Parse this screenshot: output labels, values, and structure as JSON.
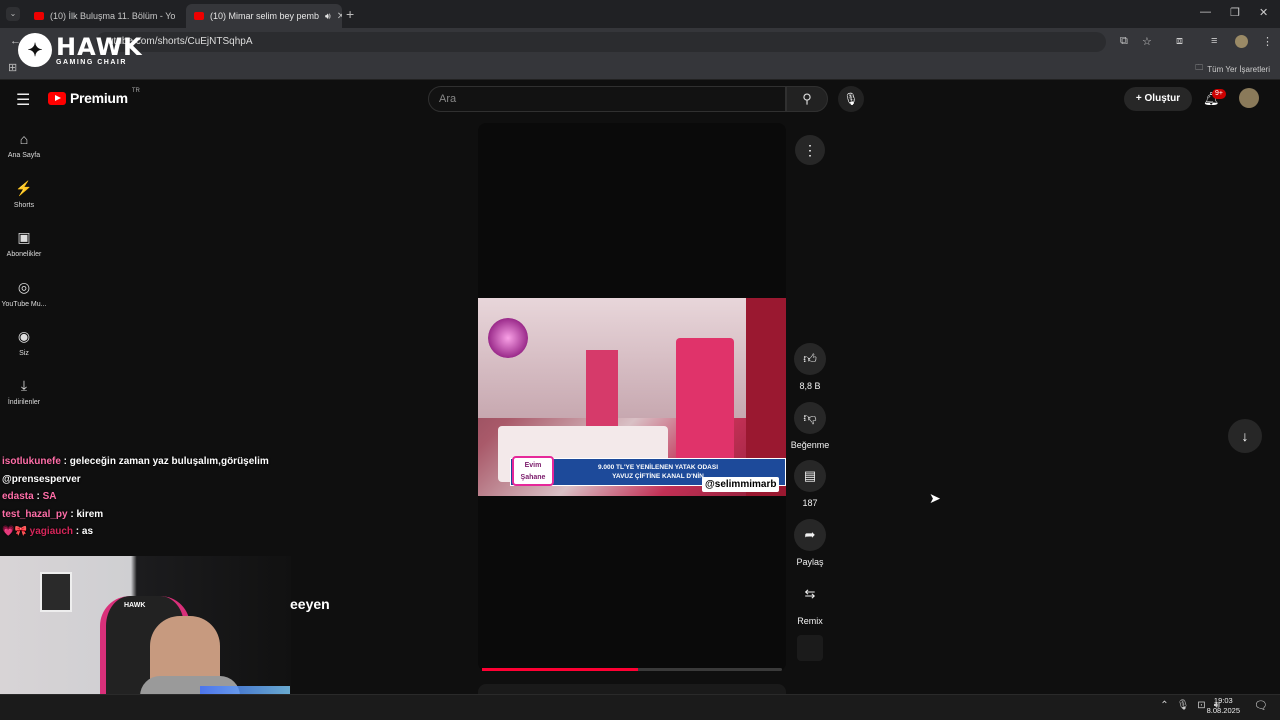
{
  "browser": {
    "tabs": [
      {
        "title": "(10) İlk Buluşma 11. Bölüm - Yo",
        "close": "✕"
      },
      {
        "title": "(10) Mimar selim bey pemb",
        "close": "✕"
      }
    ],
    "new_tab": "+",
    "url": "utube.com/shorts/CuEjNTSqhpA",
    "bookmarks_label": "Tüm Yer İşaretleri",
    "window_controls": [
      "—",
      "❐",
      "✕"
    ]
  },
  "overlay_brand": {
    "name": "HAWK",
    "tagline": "GAMING CHAIR"
  },
  "youtube": {
    "logo_text": "Premium",
    "logo_region": "TR",
    "search_placeholder": "Ara",
    "create_label": "Oluştur",
    "notifications_badge": "9+",
    "guide": [
      {
        "icon": "⌂",
        "label": "Ana Sayfa"
      },
      {
        "icon": "⚡",
        "label": "Shorts"
      },
      {
        "icon": "▣",
        "label": "Abonelikler"
      },
      {
        "icon": "◎",
        "label": "YouTube Mu..."
      },
      {
        "icon": "◉",
        "label": "Siz"
      },
      {
        "icon": "⤓",
        "label": "İndirilenler"
      }
    ],
    "short": {
      "overlay_handle": "@selimmimarb",
      "banner_logo_top": "Evim",
      "banner_logo_bottom": "Şahane",
      "banner_line1": "9.000 TL'YE YENİLENEN YATAK ODASI",
      "banner_line2": "YAVUZ ÇİFTİNE KANAL D'NİN",
      "progress": 0.52
    },
    "actions": {
      "like_count": "8,8 B",
      "dislike_label": "Beğenme",
      "comment_count": "187",
      "share_label": "Paylaş",
      "remix_label": "Remix"
    },
    "ghost_title": "eeyen"
  },
  "chat": [
    {
      "user": "isotlukunefe",
      "message": "geleceğin zaman yaz buluşalım,görüşelim"
    },
    {
      "user": "",
      "message": "@prensesperver"
    },
    {
      "user": "edasta",
      "message": "SA"
    },
    {
      "user": "test_hazal_py",
      "message": "kirem"
    },
    {
      "user": "💗🎀 yagiauch",
      "message": "as"
    }
  ],
  "webcam": {
    "chair_brand": "HAWK"
  },
  "taskbar": {
    "time": "19:03",
    "date": "8.08.2025"
  }
}
